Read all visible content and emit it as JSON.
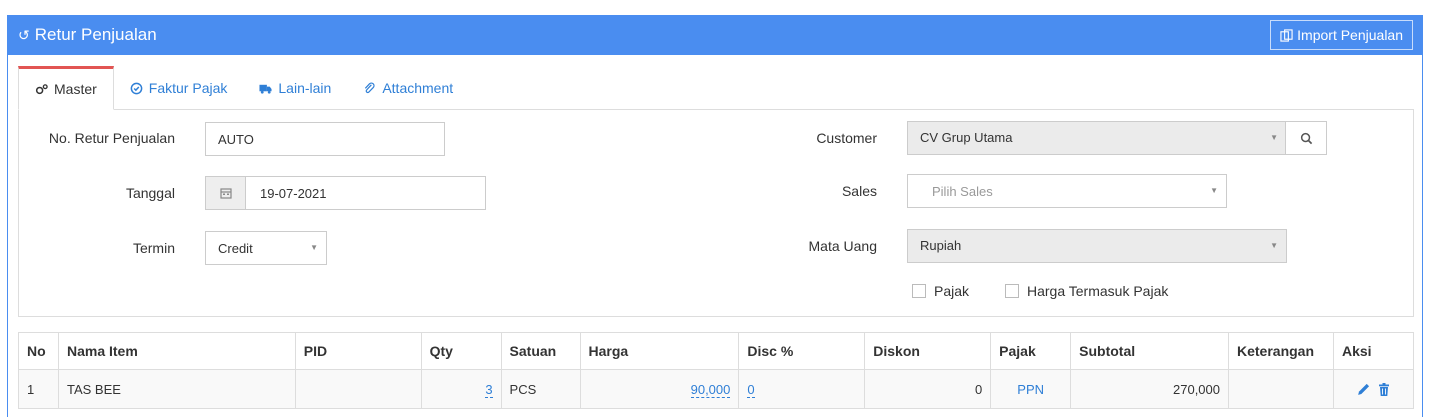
{
  "header": {
    "title": "Retur Penjualan",
    "import_label": "Import Penjualan"
  },
  "tabs": [
    {
      "label": "Master"
    },
    {
      "label": "Faktur Pajak"
    },
    {
      "label": "Lain-lain"
    },
    {
      "label": "Attachment"
    }
  ],
  "form": {
    "no_retur": {
      "label": "No. Retur Penjualan",
      "value": "AUTO"
    },
    "tanggal": {
      "label": "Tanggal",
      "value": "19-07-2021"
    },
    "termin": {
      "label": "Termin",
      "value": "Credit"
    },
    "customer": {
      "label": "Customer",
      "value": "CV Grup Utama"
    },
    "sales": {
      "label": "Sales",
      "placeholder": "Pilih Sales"
    },
    "mata_uang": {
      "label": "Mata Uang",
      "value": "Rupiah"
    },
    "pajak_label": "Pajak",
    "harga_termasuk_pajak_label": "Harga Termasuk Pajak"
  },
  "table": {
    "columns": [
      "No",
      "Nama Item",
      "PID",
      "Qty",
      "Satuan",
      "Harga",
      "Disc %",
      "Diskon",
      "Pajak",
      "Subtotal",
      "Keterangan",
      "Aksi"
    ],
    "rows": [
      {
        "no": "1",
        "nama_item": "TAS BEE",
        "pid": "",
        "qty": "3",
        "satuan": "PCS",
        "harga": "90,000",
        "disc": "0",
        "diskon": "0",
        "pajak": "PPN",
        "subtotal": "270,000",
        "keterangan": ""
      }
    ]
  },
  "colors": {
    "header_bg": "#4a8df0",
    "tab_active_border": "#e25553",
    "link": "#2f7fd6"
  }
}
